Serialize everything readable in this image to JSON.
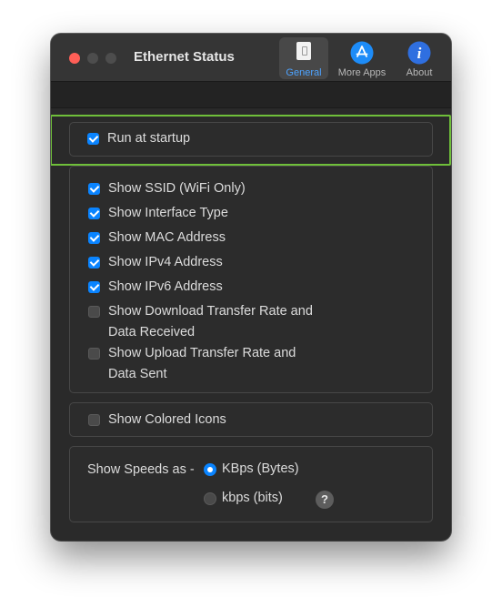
{
  "window": {
    "title": "Ethernet Status"
  },
  "toolbar": {
    "items": [
      {
        "label": "General",
        "icon": "general-switch-icon",
        "selected": true
      },
      {
        "label": "More Apps",
        "icon": "app-store-icon",
        "selected": false
      },
      {
        "label": "About",
        "icon": "info-icon",
        "selected": false
      }
    ]
  },
  "startup": {
    "label": "Run at startup",
    "checked": true
  },
  "options": [
    {
      "label": "Show SSID (WiFi Only)",
      "checked": true
    },
    {
      "label": "Show Interface Type",
      "checked": true
    },
    {
      "label": "Show MAC Address",
      "checked": true
    },
    {
      "label": "Show IPv4 Address",
      "checked": true
    },
    {
      "label": "Show IPv6 Address",
      "checked": true
    },
    {
      "label_line1": "Show Download Transfer Rate and",
      "label_line2": "Data Received",
      "checked": false
    },
    {
      "label_line1": "Show Upload Transfer Rate and",
      "label_line2": "Data Sent",
      "checked": false
    }
  ],
  "colored_icons": {
    "label": "Show Colored Icons",
    "checked": false
  },
  "speeds": {
    "label": "Show Speeds as -",
    "options": [
      {
        "label": "KBps (Bytes)",
        "selected": true
      },
      {
        "label": "kbps (bits)",
        "selected": false
      }
    ],
    "help": "?"
  },
  "colors": {
    "accent": "#0a84ff",
    "focus_ring": "#6fbf3a",
    "close_button": "#ff5f57"
  }
}
